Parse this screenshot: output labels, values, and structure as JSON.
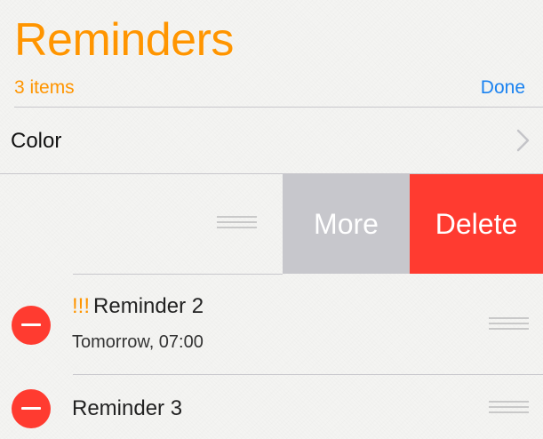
{
  "header": {
    "title": "Reminders",
    "item_count": "3 items",
    "done_label": "Done"
  },
  "color_row": {
    "label": "Color",
    "icon": "chevron-right-icon"
  },
  "swipe_actions": {
    "more_label": "More",
    "delete_label": "Delete"
  },
  "reminders": [
    {
      "priority": "!!!",
      "title": "Reminder 2",
      "due": "Tomorrow, 07:00"
    },
    {
      "priority": "",
      "title": "Reminder 3",
      "due": ""
    }
  ],
  "colors": {
    "accent": "#ff9500",
    "link": "#1a82f0",
    "destructive": "#ff3b30",
    "more_button": "#c7c7cc",
    "separator": "#c8c7cc"
  }
}
